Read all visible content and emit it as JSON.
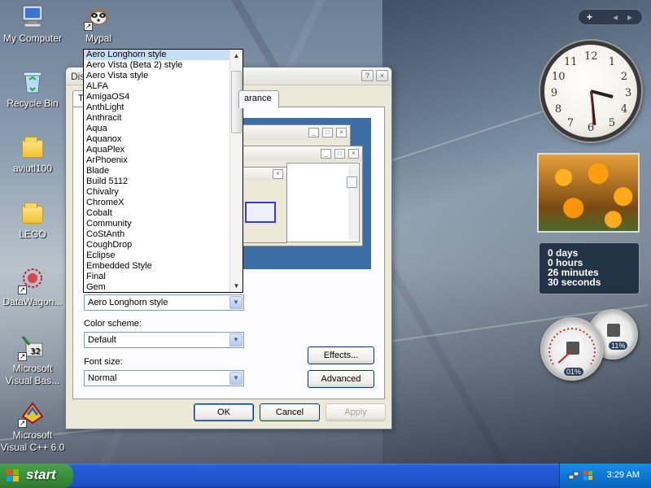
{
  "desktop": {
    "icons": [
      {
        "label": "My Computer",
        "icon": "my-computer-icon"
      },
      {
        "label": "Mypal",
        "icon": "mypal-raccoon-icon"
      },
      {
        "label": "Recycle Bin",
        "icon": "recycle-bin-icon"
      },
      {
        "label": "aviutl100",
        "icon": "folder-icon"
      },
      {
        "label": "LEGO",
        "icon": "folder-icon"
      },
      {
        "label": "DataWagon...",
        "icon": "datawagon-icon"
      },
      {
        "label": "Microsoft Visual Bas...",
        "icon": "visual-basic-icon"
      },
      {
        "label": "Microsoft Visual C++ 6.0",
        "icon": "visual-cpp-icon"
      }
    ]
  },
  "dialog": {
    "title": "Dis",
    "tab_first": "T",
    "tab_active": "arance",
    "help_btn": "?",
    "close_btn": "×",
    "preview": {
      "win_min": "_",
      "win_max": "□",
      "win_close": "×"
    },
    "windows_and_buttons": {
      "value": "Aero Longhorn style"
    },
    "color_scheme": {
      "label": "Color scheme:",
      "value": "Default"
    },
    "font_size": {
      "label": "Font size:",
      "value": "Normal"
    },
    "effects_button": "Effects...",
    "advanced_button": "Advanced",
    "ok_button": "OK",
    "cancel_button": "Cancel",
    "apply_button": "Apply"
  },
  "dropdown": {
    "selected": "Aero Longhorn style",
    "items": [
      "Aero Longhorn style",
      "Aero Vista (Beta 2) style",
      "Aero Vista style",
      "ALFA",
      "AmigaOS4",
      "AnthLight",
      "Anthracit",
      "Aqua",
      "Aquanox",
      "AquaPlex",
      "ArPhoenix",
      "Blade",
      "Build 5112",
      "Chivalry",
      "ChromeX",
      "Cobalt",
      "Community",
      "CoStAnth",
      "CoughDrop",
      "Eclipse",
      "Embedded Style",
      "Final",
      "Gem"
    ]
  },
  "sidebar": {
    "add_btn": "+",
    "prev_btn": "◂",
    "next_btn": "▸",
    "clock": {
      "numerals": [
        "12",
        "1",
        "2",
        "3",
        "4",
        "5",
        "6",
        "7",
        "8",
        "9",
        "10",
        "11"
      ],
      "time": "3:29"
    },
    "uptime": {
      "days": "0 days",
      "hours": "0 hours",
      "minutes": "26 minutes",
      "seconds": "30 seconds"
    },
    "cpu_meter": {
      "value": "01%",
      "level": 0.01
    },
    "memory_meter": {
      "value": "11%",
      "level": 0.11
    }
  },
  "taskbar": {
    "start_label": "start",
    "clock": "3:29 AM"
  },
  "colors": {
    "taskbar_blue": "#245edb",
    "start_green": "#3c8f3e",
    "dialog_bg": "#ece9d8",
    "preview_desktop": "#3a6ea5",
    "selection": "#c8ddf7"
  }
}
